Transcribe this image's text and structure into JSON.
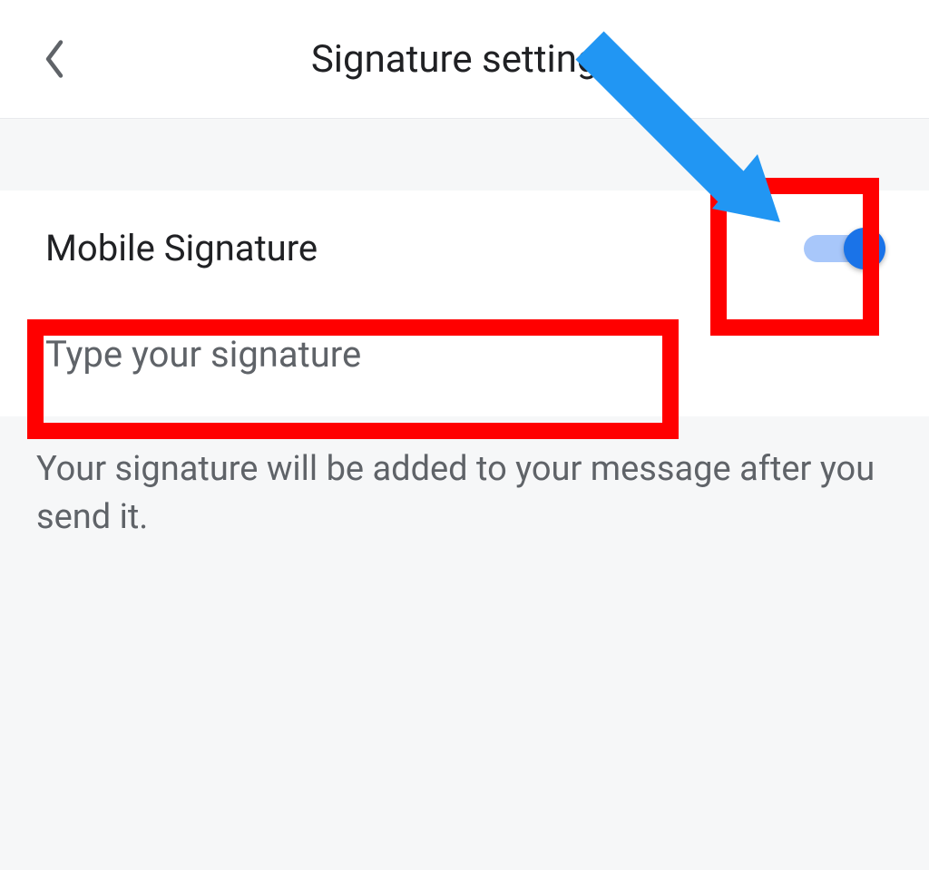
{
  "header": {
    "title": "Signature settings"
  },
  "mobile_signature": {
    "label": "Mobile Signature",
    "enabled": true
  },
  "signature_input": {
    "value": "",
    "placeholder": "Type your signature"
  },
  "helper_text": "Your signature will be added to your message after you send it.",
  "annotations": {
    "highlight_color": "#ff0000",
    "arrow_color": "#2196f3"
  }
}
